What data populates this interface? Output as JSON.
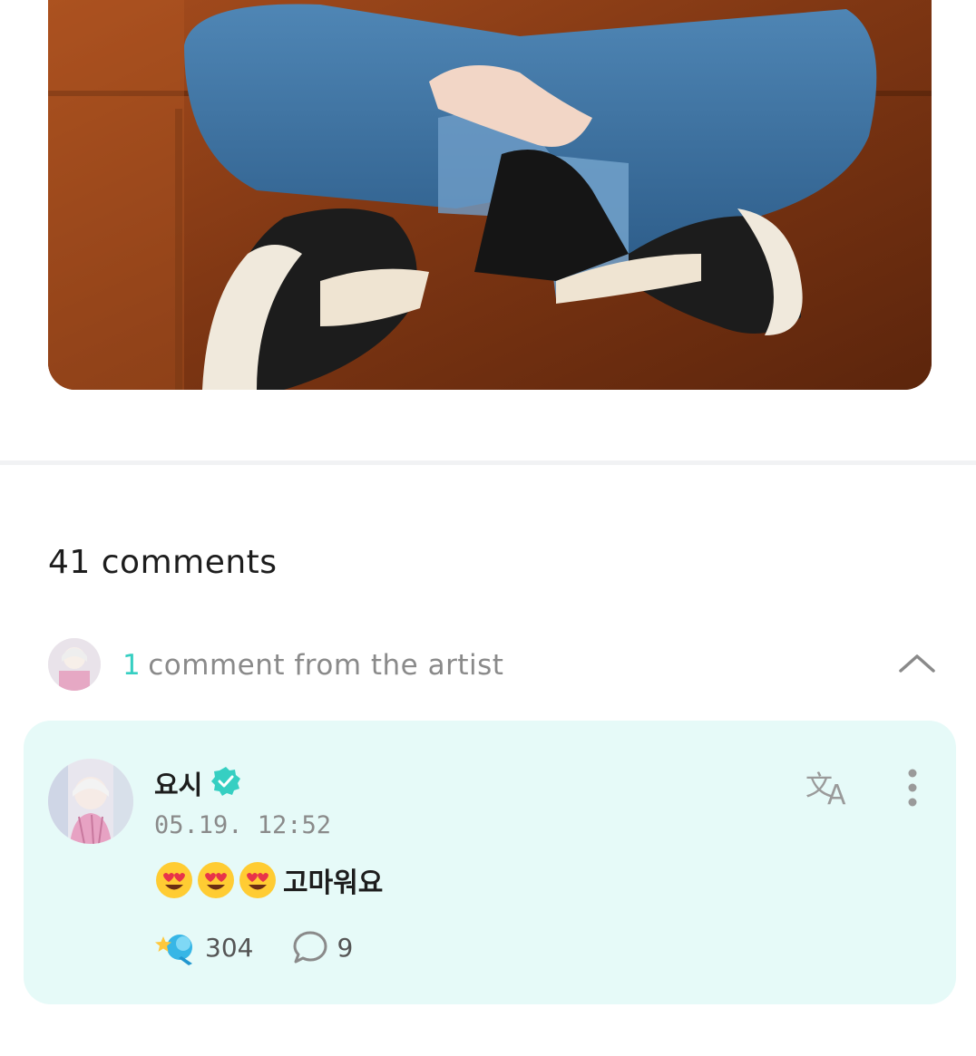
{
  "post": {
    "image_alt": "photo"
  },
  "comments": {
    "count_label": "41 comments",
    "artist_section": {
      "count": "1",
      "label": "comment from the artist"
    },
    "artist_comment": {
      "author": "요시",
      "verified": true,
      "timestamp": "05.19. 12:52",
      "emojis": [
        "heart-eyes-emoji",
        "heart-eyes-emoji",
        "heart-eyes-emoji"
      ],
      "text": "고마워요",
      "likes": "304",
      "replies": "9"
    }
  },
  "colors": {
    "accent": "#36cfc2",
    "comment_bg": "#e6faf8"
  }
}
